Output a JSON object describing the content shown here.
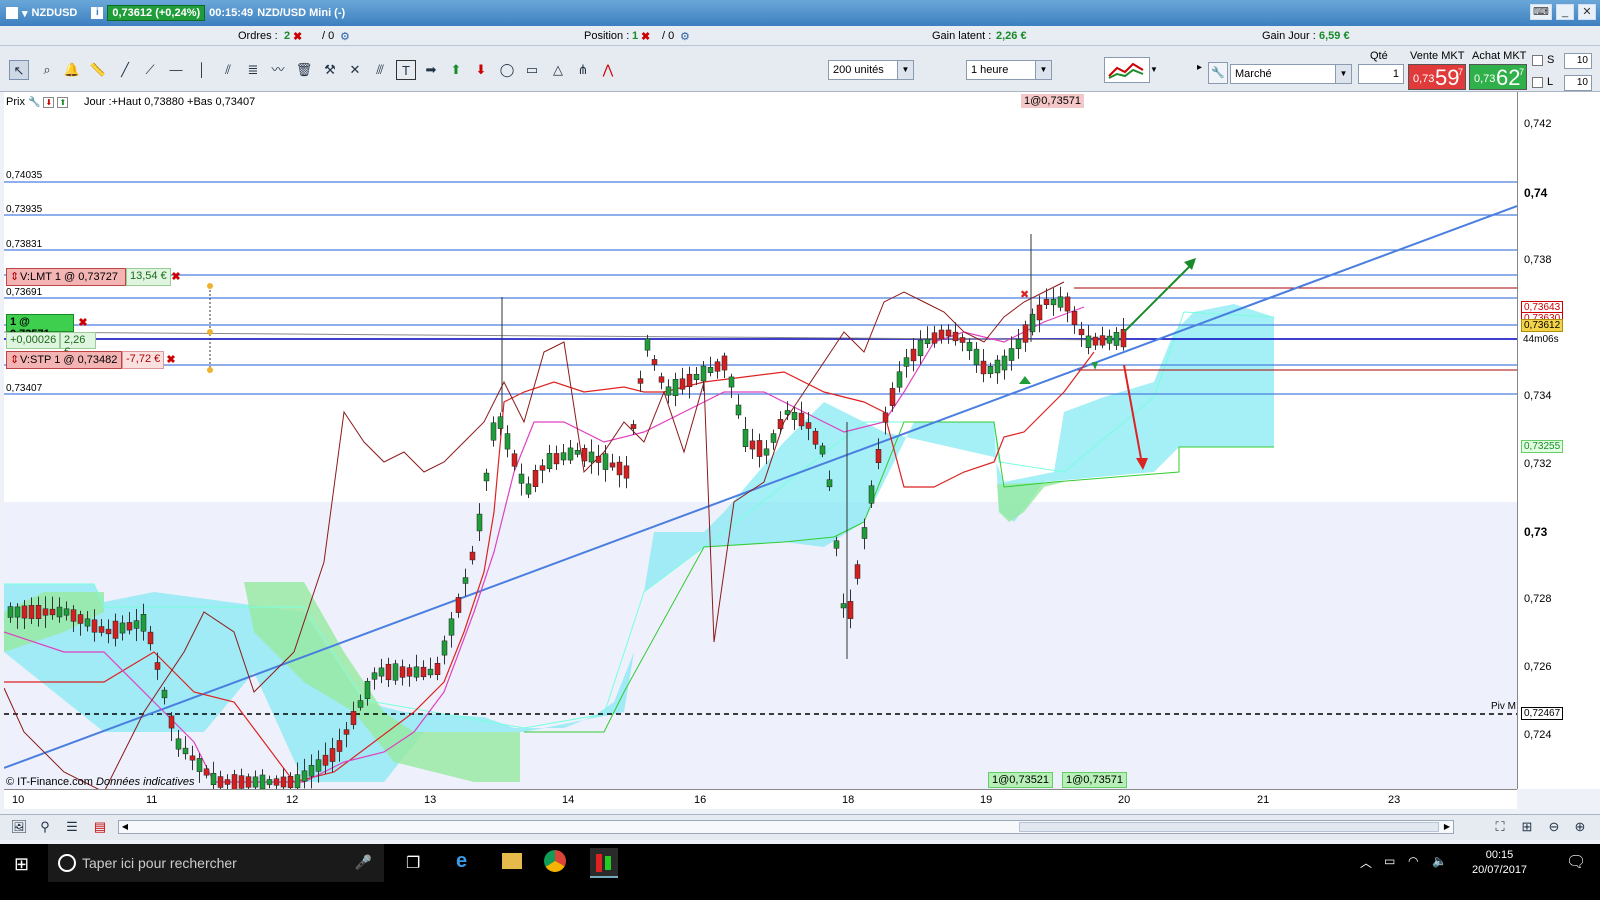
{
  "window": {
    "symbol": "NZDUSD",
    "price_badge": "0,73612 (+0,24%)",
    "time": "00:15:49",
    "instrument": "NZD/USD Mini (-)"
  },
  "infobar": {
    "orders_label": "Ordres :",
    "orders_value": "2",
    "orders_sep": "/ 0",
    "position_label": "Position :",
    "position_value": "1",
    "position_sep": "/ 0",
    "gain_latent_label": "Gain latent :",
    "gain_latent_value": "2,26 €",
    "gain_jour_label": "Gain Jour :",
    "gain_jour_value": "6,59 €"
  },
  "toolbar": {
    "units_combo": "200 unités",
    "period_combo": "1 heure"
  },
  "trade_panel": {
    "order_type": "Marché",
    "qty_label": "Qté",
    "qty_value": "1",
    "sell_label": "Vente MKT",
    "buy_label": "Achat MKT",
    "sell_small": "0,73",
    "sell_big": "59",
    "sell_exp": "7",
    "buy_small": "0,73",
    "buy_big": "62",
    "buy_exp": "7",
    "s_label": "S",
    "l_label": "L",
    "s_value": "10",
    "l_value": "10"
  },
  "chart": {
    "header_prix": "Prix",
    "header_text": "Jour :+Haut 0,73880 +Bas 0,73407",
    "top_marker": "1@0,73571",
    "copyright": "© IT-Finance.com",
    "donnees": "Données indicatives",
    "piv_label": "Piv M",
    "bottom_marker_1": "1@0,73521",
    "bottom_marker_2": "1@0,73571",
    "level_labels": [
      "0,74035",
      "0,73935",
      "0,73831",
      "0,73691",
      "0,73407"
    ],
    "orders": {
      "lmt_label": "V:LMT  1 @ 0,73727",
      "lmt_gain": "13,54 €",
      "pos_label": "1 @ 0,73571",
      "pos_diff": "+0,00026",
      "pos_gain": "2,26 €",
      "stp_label": "V:STP  1 @ 0,73482",
      "stp_gain": "-7,72 €"
    },
    "yaxis_ticks": [
      {
        "v": "0,742",
        "big": false
      },
      {
        "v": "0,74",
        "big": true
      },
      {
        "v": "0,738",
        "big": false
      },
      {
        "v": "0,734",
        "big": false
      },
      {
        "v": "0,732",
        "big": false
      },
      {
        "v": "0,73",
        "big": true
      },
      {
        "v": "0,728",
        "big": false
      },
      {
        "v": "0,726",
        "big": false
      },
      {
        "v": "0,724",
        "big": false
      }
    ],
    "yaxis_labels": {
      "red_top": "0,73643",
      "red_mid": "0,73630",
      "current": "0,73612",
      "countdown": "44m06s",
      "cloud": "0,73255",
      "pivot": "0,72467"
    },
    "xaxis_ticks": [
      "10",
      "11",
      "12",
      "13",
      "14",
      "16",
      "18",
      "19",
      "20",
      "21",
      "23"
    ]
  },
  "taskbar": {
    "search_placeholder": "Taper ici pour rechercher",
    "time": "00:15",
    "date": "20/07/2017"
  },
  "colors": {
    "titlebar": "#3d80c0",
    "bull": "#1f9d3a",
    "bear": "#d22020",
    "cloud_cyan": "#7fe8f2",
    "cloud_green": "#96eaa0",
    "trend": "#4a7fe0"
  }
}
